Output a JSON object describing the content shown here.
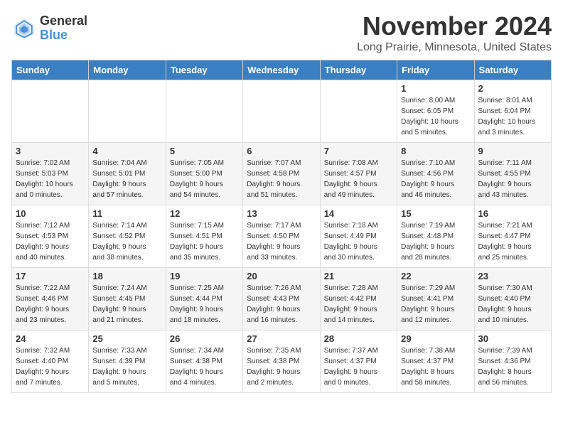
{
  "header": {
    "logo_line1": "General",
    "logo_line2": "Blue",
    "month": "November 2024",
    "location": "Long Prairie, Minnesota, United States"
  },
  "weekdays": [
    "Sunday",
    "Monday",
    "Tuesday",
    "Wednesday",
    "Thursday",
    "Friday",
    "Saturday"
  ],
  "weeks": [
    [
      {
        "day": "",
        "info": ""
      },
      {
        "day": "",
        "info": ""
      },
      {
        "day": "",
        "info": ""
      },
      {
        "day": "",
        "info": ""
      },
      {
        "day": "",
        "info": ""
      },
      {
        "day": "1",
        "info": "Sunrise: 8:00 AM\nSunset: 6:05 PM\nDaylight: 10 hours\nand 5 minutes."
      },
      {
        "day": "2",
        "info": "Sunrise: 8:01 AM\nSunset: 6:04 PM\nDaylight: 10 hours\nand 3 minutes."
      }
    ],
    [
      {
        "day": "3",
        "info": "Sunrise: 7:02 AM\nSunset: 5:03 PM\nDaylight: 10 hours\nand 0 minutes."
      },
      {
        "day": "4",
        "info": "Sunrise: 7:04 AM\nSunset: 5:01 PM\nDaylight: 9 hours\nand 57 minutes."
      },
      {
        "day": "5",
        "info": "Sunrise: 7:05 AM\nSunset: 5:00 PM\nDaylight: 9 hours\nand 54 minutes."
      },
      {
        "day": "6",
        "info": "Sunrise: 7:07 AM\nSunset: 4:58 PM\nDaylight: 9 hours\nand 51 minutes."
      },
      {
        "day": "7",
        "info": "Sunrise: 7:08 AM\nSunset: 4:57 PM\nDaylight: 9 hours\nand 49 minutes."
      },
      {
        "day": "8",
        "info": "Sunrise: 7:10 AM\nSunset: 4:56 PM\nDaylight: 9 hours\nand 46 minutes."
      },
      {
        "day": "9",
        "info": "Sunrise: 7:11 AM\nSunset: 4:55 PM\nDaylight: 9 hours\nand 43 minutes."
      }
    ],
    [
      {
        "day": "10",
        "info": "Sunrise: 7:12 AM\nSunset: 4:53 PM\nDaylight: 9 hours\nand 40 minutes."
      },
      {
        "day": "11",
        "info": "Sunrise: 7:14 AM\nSunset: 4:52 PM\nDaylight: 9 hours\nand 38 minutes."
      },
      {
        "day": "12",
        "info": "Sunrise: 7:15 AM\nSunset: 4:51 PM\nDaylight: 9 hours\nand 35 minutes."
      },
      {
        "day": "13",
        "info": "Sunrise: 7:17 AM\nSunset: 4:50 PM\nDaylight: 9 hours\nand 33 minutes."
      },
      {
        "day": "14",
        "info": "Sunrise: 7:18 AM\nSunset: 4:49 PM\nDaylight: 9 hours\nand 30 minutes."
      },
      {
        "day": "15",
        "info": "Sunrise: 7:19 AM\nSunset: 4:48 PM\nDaylight: 9 hours\nand 28 minutes."
      },
      {
        "day": "16",
        "info": "Sunrise: 7:21 AM\nSunset: 4:47 PM\nDaylight: 9 hours\nand 25 minutes."
      }
    ],
    [
      {
        "day": "17",
        "info": "Sunrise: 7:22 AM\nSunset: 4:46 PM\nDaylight: 9 hours\nand 23 minutes."
      },
      {
        "day": "18",
        "info": "Sunrise: 7:24 AM\nSunset: 4:45 PM\nDaylight: 9 hours\nand 21 minutes."
      },
      {
        "day": "19",
        "info": "Sunrise: 7:25 AM\nSunset: 4:44 PM\nDaylight: 9 hours\nand 18 minutes."
      },
      {
        "day": "20",
        "info": "Sunrise: 7:26 AM\nSunset: 4:43 PM\nDaylight: 9 hours\nand 16 minutes."
      },
      {
        "day": "21",
        "info": "Sunrise: 7:28 AM\nSunset: 4:42 PM\nDaylight: 9 hours\nand 14 minutes."
      },
      {
        "day": "22",
        "info": "Sunrise: 7:29 AM\nSunset: 4:41 PM\nDaylight: 9 hours\nand 12 minutes."
      },
      {
        "day": "23",
        "info": "Sunrise: 7:30 AM\nSunset: 4:40 PM\nDaylight: 9 hours\nand 10 minutes."
      }
    ],
    [
      {
        "day": "24",
        "info": "Sunrise: 7:32 AM\nSunset: 4:40 PM\nDaylight: 9 hours\nand 7 minutes."
      },
      {
        "day": "25",
        "info": "Sunrise: 7:33 AM\nSunset: 4:39 PM\nDaylight: 9 hours\nand 5 minutes."
      },
      {
        "day": "26",
        "info": "Sunrise: 7:34 AM\nSunset: 4:38 PM\nDaylight: 9 hours\nand 4 minutes."
      },
      {
        "day": "27",
        "info": "Sunrise: 7:35 AM\nSunset: 4:38 PM\nDaylight: 9 hours\nand 2 minutes."
      },
      {
        "day": "28",
        "info": "Sunrise: 7:37 AM\nSunset: 4:37 PM\nDaylight: 9 hours\nand 0 minutes."
      },
      {
        "day": "29",
        "info": "Sunrise: 7:38 AM\nSunset: 4:37 PM\nDaylight: 8 hours\nand 58 minutes."
      },
      {
        "day": "30",
        "info": "Sunrise: 7:39 AM\nSunset: 4:36 PM\nDaylight: 8 hours\nand 56 minutes."
      }
    ]
  ]
}
